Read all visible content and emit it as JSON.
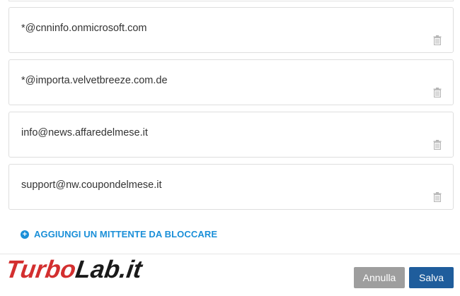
{
  "entries": [
    {
      "email": "*@cnninfo.onmicrosoft.com"
    },
    {
      "email": "*@importa.velvetbreeze.com.de"
    },
    {
      "email": "info@news.affaredelmese.it"
    },
    {
      "email": "support@nw.coupondelmese.it"
    }
  ],
  "add_link": {
    "icon": "plus-circle-icon",
    "label": "AGGIUNGI UN MITTENTE DA BLOCCARE"
  },
  "watermark": {
    "text_part1": "Turbo",
    "text_part2": "Lab.it"
  },
  "buttons": {
    "cancel_label": "Annulla",
    "save_label": "Salva"
  },
  "colors": {
    "accent": "#1a8fd8",
    "save": "#1f5d9c",
    "cancel": "#9e9e9e",
    "logo_red": "#d32f2f"
  }
}
